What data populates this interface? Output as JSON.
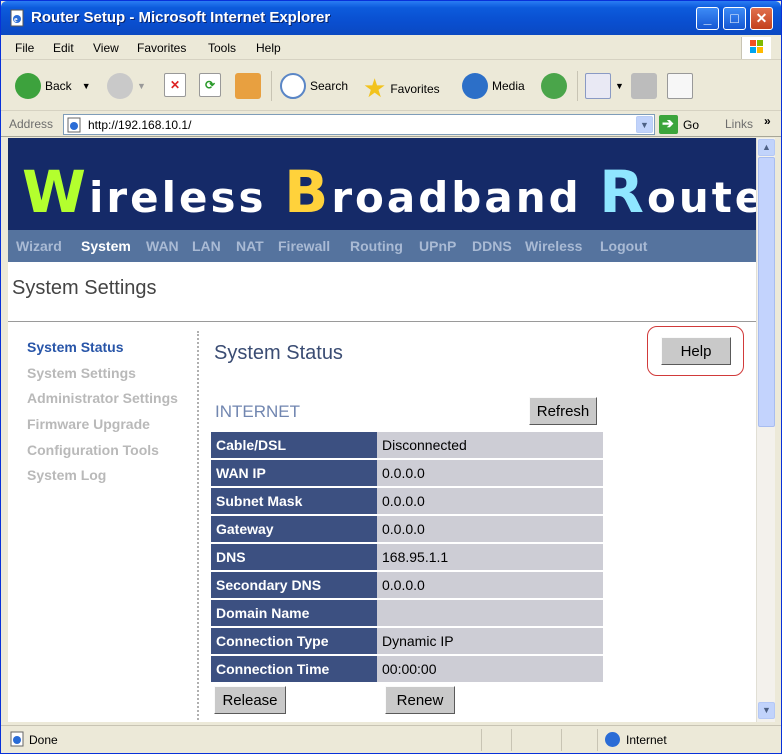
{
  "window": {
    "title": "Router Setup - Microsoft Internet Explorer"
  },
  "menu": [
    "File",
    "Edit",
    "View",
    "Favorites",
    "Tools",
    "Help"
  ],
  "toolbar": {
    "back": "Back",
    "search": "Search",
    "favorites": "Favorites",
    "media": "Media"
  },
  "address": {
    "label": "Address",
    "url": "http://192.168.10.1/",
    "go": "Go",
    "links": "Links"
  },
  "banner": {
    "w": "W",
    "ireless": "ireless",
    "b": "B",
    "roadband": "roadband",
    "r": "R",
    "outer": "outer"
  },
  "nav": [
    "Wizard",
    "System",
    "WAN",
    "LAN",
    "NAT",
    "Firewall",
    "Routing",
    "UPnP",
    "DDNS",
    "Wireless",
    "Logout"
  ],
  "page_title": "System Settings",
  "sidebar": [
    "System Status",
    "System Settings",
    "Administrator Settings",
    "Firmware Upgrade",
    "Configuration Tools",
    "System Log"
  ],
  "section": {
    "title": "System Status",
    "help": "Help",
    "internet": "INTERNET",
    "refresh": "Refresh",
    "release": "Release",
    "renew": "Renew"
  },
  "status_rows": [
    {
      "label": "Cable/DSL",
      "value": "Disconnected"
    },
    {
      "label": "WAN IP",
      "value": "0.0.0.0"
    },
    {
      "label": "Subnet Mask",
      "value": "0.0.0.0"
    },
    {
      "label": "Gateway",
      "value": "0.0.0.0"
    },
    {
      "label": "DNS",
      "value": "168.95.1.1"
    },
    {
      "label": "Secondary DNS",
      "value": "0.0.0.0"
    },
    {
      "label": "Domain Name",
      "value": ""
    },
    {
      "label": "Connection Type",
      "value": "Dynamic IP"
    },
    {
      "label": "Connection Time",
      "value": "00:00:00"
    }
  ],
  "statusbar": {
    "left": "Done",
    "zone": "Internet"
  }
}
